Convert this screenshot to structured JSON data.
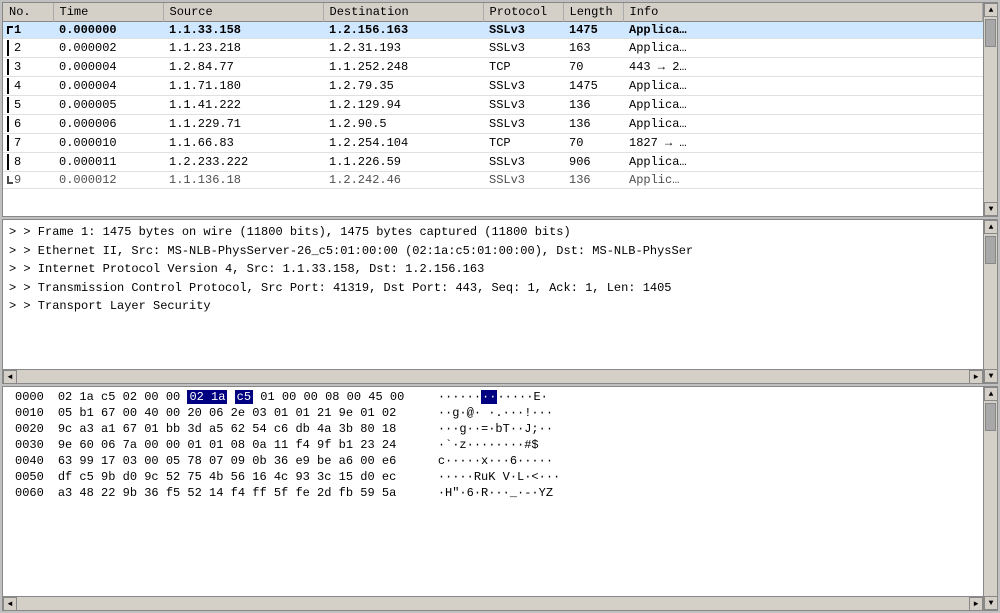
{
  "header": {
    "columns": [
      "No.",
      "Time",
      "Source",
      "Destination",
      "Protocol",
      "Length",
      "Info"
    ]
  },
  "packets": [
    {
      "no": "1",
      "time": "0.000000",
      "source": "1.1.33.158",
      "destination": "1.2.156.163",
      "protocol": "SSLv3",
      "length": "1475",
      "info": "Applica…",
      "selected": true,
      "bold": true
    },
    {
      "no": "2",
      "time": "0.000002",
      "source": "1.1.23.218",
      "destination": "1.2.31.193",
      "protocol": "SSLv3",
      "length": "163",
      "info": "Applica…",
      "selected": false
    },
    {
      "no": "3",
      "time": "0.000004",
      "source": "1.2.84.77",
      "destination": "1.1.252.248",
      "protocol": "TCP",
      "length": "70",
      "info": "443 → 2…",
      "selected": false
    },
    {
      "no": "4",
      "time": "0.000004",
      "source": "1.1.71.180",
      "destination": "1.2.79.35",
      "protocol": "SSLv3",
      "length": "1475",
      "info": "Applica…",
      "selected": false
    },
    {
      "no": "5",
      "time": "0.000005",
      "source": "1.1.41.222",
      "destination": "1.2.129.94",
      "protocol": "SSLv3",
      "length": "136",
      "info": "Applica…",
      "selected": false
    },
    {
      "no": "6",
      "time": "0.000006",
      "source": "1.1.229.71",
      "destination": "1.2.90.5",
      "protocol": "SSLv3",
      "length": "136",
      "info": "Applica…",
      "selected": false
    },
    {
      "no": "7",
      "time": "0.000010",
      "source": "1.1.66.83",
      "destination": "1.2.254.104",
      "protocol": "TCP",
      "length": "70",
      "info": "1827 → …",
      "selected": false
    },
    {
      "no": "8",
      "time": "0.000011",
      "source": "1.2.233.222",
      "destination": "1.1.226.59",
      "protocol": "SSLv3",
      "length": "906",
      "info": "Applica…",
      "selected": false
    },
    {
      "no": "9",
      "time": "0.000012",
      "source": "1.1.136.18",
      "destination": "1.2.242.46",
      "protocol": "SSLv3",
      "length": "136",
      "info": "Applic…",
      "selected": false,
      "partial": true
    }
  ],
  "detail_lines": [
    "Frame 1: 1475 bytes on wire (11800 bits), 1475 bytes captured (11800 bits)",
    "Ethernet II, Src: MS-NLB-PhysServer-26_c5:01:00:00 (02:1a:c5:01:00:00), Dst: MS-NLB-PhysSer",
    "Internet Protocol Version 4, Src: 1.1.33.158, Dst: 1.2.156.163",
    "Transmission Control Protocol, Src Port: 41319, Dst Port: 443, Seq: 1, Ack: 1, Len: 1405",
    "Transport Layer Security"
  ],
  "hex_rows": [
    {
      "offset": "0000",
      "bytes": "02 1a c5 02 00 00 02 1a  c5 01 00 00 08 00 45 00",
      "ascii": "··············E.",
      "highlight_start": 6,
      "highlight_end": 8
    },
    {
      "offset": "0010",
      "bytes": "05 b1 67 00 40 00 20 06  2e 03 01 01 21 9e 01 02",
      "ascii": "··g·@· ·.···!···"
    },
    {
      "offset": "0020",
      "bytes": "9c a3 a1 67 01 bb 3d a5  62 54 c6 db 4a 3b 80 18",
      "ascii": "···g··=·bT··J;··"
    },
    {
      "offset": "0030",
      "bytes": "9e 60 06 7a 00 00 01 01  08 0a 11 f4 9f b1 23 24",
      "ascii": "·`·z········#$"
    },
    {
      "offset": "0040",
      "bytes": "63 99 17 03 00 05 78 07  09 0b 36 e9 be a6 00 e6",
      "ascii": "c·····x···6·····"
    },
    {
      "offset": "0050",
      "bytes": "df c5 9b d0 9c 52 75 4b  56 16 4c 93 3c 15 d0 ec",
      "ascii": "·····RuKV·L·<···"
    },
    {
      "offset": "0060",
      "bytes": "a3 48 22 9b 36 f5 52 14  f4 ff 5f fe 2d fb 59 5a",
      "ascii": "·H\"·6·R···_·-·YZ"
    }
  ],
  "hex_ascii_col": [
    "·····̲··̲·····E·",
    "··g·@· ·.···!···",
    "···g··=·bT··J;··",
    "·`·z········#$",
    "c·····x···6·····",
    "·····RuK V·L·<···",
    "·H\"·6·R···_·-·YZ"
  ],
  "hex_display": [
    {
      "offset": "0000",
      "h1": "02 1a c5 02 00 00",
      "h2": "02 1a",
      "h3": "c5",
      "h4": "01 00 00 08 00 45 00",
      "ascii_plain": "······",
      "ascii_hi": "··",
      "ascii_rest": "·····E·"
    },
    {
      "offset": "0010",
      "hex": "05 b1 67 00 40 00 20 06  2e 03 01 01 21 9e 01 02",
      "ascii": "··g·@·  ·.···!···"
    },
    {
      "offset": "0020",
      "hex": "9c a3 a1 67 01 bb 3d a5  62 54 c6 db 4a 3b 80 18",
      "ascii": "···g··=· bT··J;··"
    },
    {
      "offset": "0030",
      "hex": "9e 60 06 7a 00 00 01 01  08 0a 11 f4 9f b1 23 24",
      "ascii": "·`·z·····  ···#$"
    },
    {
      "offset": "0040",
      "hex": "63 99 17 03 00 05 78 07  09 0b 36 e9 be a6 00 e6",
      "ascii": "c·····x· ··6·····"
    },
    {
      "offset": "0050",
      "hex": "df c5 9b d0 9c 52 75 4b  56 16 4c 93 3c 15 d0 ec",
      "ascii": "·····RuK V·L·<···"
    },
    {
      "offset": "0060",
      "hex": "a3 48 22 9b 36 f5 52 14  f4 ff 5f fe 2d fb 59 5a",
      "ascii": "·H\"·6·R· ··_·-·YZ"
    }
  ]
}
